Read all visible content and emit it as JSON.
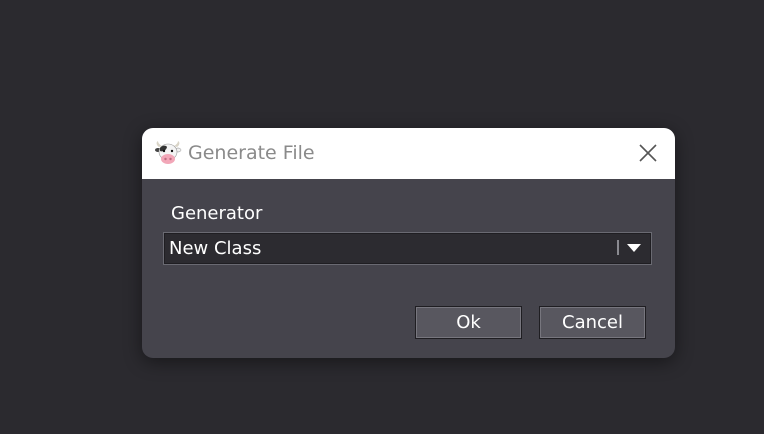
{
  "dialog": {
    "title": "Generate File",
    "app_icon": "cow-icon",
    "close_icon": "close-icon",
    "generator_label": "Generator",
    "generator_select": {
      "value": "New Class",
      "arrow_icon": "chevron-down-icon"
    },
    "ok_label": "Ok",
    "cancel_label": "Cancel"
  },
  "colors": {
    "desktop_background": "#2b2a2f",
    "dialog_body": "#45444c",
    "titlebar": "#ffffff",
    "title_text": "#8a8a8a",
    "button_fill": "#58575f"
  }
}
